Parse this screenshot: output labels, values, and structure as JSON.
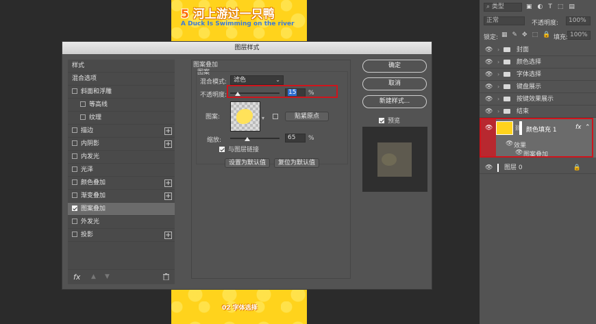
{
  "canvas": {
    "title_num": "5",
    "title": "河上游过一只鸭",
    "subtitle": "A Duck Is Swimming on the river",
    "footer": "02 字体选择",
    "bg_color": "#ffd31c"
  },
  "dialog": {
    "title": "图层样式",
    "style_list": [
      {
        "label": "样式",
        "checkbox": null,
        "indent": false,
        "plus": false,
        "active": false
      },
      {
        "label": "混合选项",
        "checkbox": null,
        "indent": false,
        "plus": false,
        "active": false
      },
      {
        "label": "斜面和浮雕",
        "checkbox": false,
        "indent": false,
        "plus": false,
        "active": false
      },
      {
        "label": "等高线",
        "checkbox": false,
        "indent": true,
        "plus": false,
        "active": false
      },
      {
        "label": "纹理",
        "checkbox": false,
        "indent": true,
        "plus": false,
        "active": false
      },
      {
        "label": "描边",
        "checkbox": false,
        "indent": false,
        "plus": true,
        "active": false
      },
      {
        "label": "内阴影",
        "checkbox": false,
        "indent": false,
        "plus": true,
        "active": false
      },
      {
        "label": "内发光",
        "checkbox": false,
        "indent": false,
        "plus": false,
        "active": false
      },
      {
        "label": "光泽",
        "checkbox": false,
        "indent": false,
        "plus": false,
        "active": false
      },
      {
        "label": "颜色叠加",
        "checkbox": false,
        "indent": false,
        "plus": true,
        "active": false
      },
      {
        "label": "渐变叠加",
        "checkbox": false,
        "indent": false,
        "plus": true,
        "active": false
      },
      {
        "label": "图案叠加",
        "checkbox": true,
        "indent": false,
        "plus": false,
        "active": true
      },
      {
        "label": "外发光",
        "checkbox": false,
        "indent": false,
        "plus": false,
        "active": false
      },
      {
        "label": "投影",
        "checkbox": false,
        "indent": false,
        "plus": true,
        "active": false
      }
    ],
    "footer": {
      "fx": "fx",
      "up": "▲",
      "down": "▼",
      "trash": "🗑"
    },
    "section_title": "图案叠加",
    "group_title": "图案",
    "blend_mode_label": "混合模式:",
    "blend_mode_value": "滤色",
    "opacity_label": "不透明度:",
    "opacity_value": "15",
    "opacity_level": 0.15,
    "percent": "%",
    "pattern_label": "图案:",
    "snap_origin_button": "贴紧原点",
    "scale_label": "缩放:",
    "scale_value": "65",
    "scale_level": 0.35,
    "link_label": "与图层链接",
    "link_checked": true,
    "set_default_button": "设置为默认值",
    "reset_default_button": "复位为默认值",
    "ok_button": "确定",
    "cancel_button": "取消",
    "new_style_button": "新建样式...",
    "preview_label": "预览",
    "preview_checked": true
  },
  "layers_panel": {
    "kind_placeholder": "类型",
    "blend_mode": "正常",
    "opacity_label": "不透明度:",
    "opacity_value": "100%",
    "lock_label": "锁定:",
    "fill_label": "填充:",
    "fill_value": "100%",
    "folders": [
      "封面",
      "颜色选择",
      "字体选择",
      "键盘展示",
      "按键效果展示",
      "结束"
    ],
    "selected_layer": {
      "name": "颜色填充 1",
      "fx": "fx",
      "effects_label": "效果",
      "effect": "图案叠加"
    },
    "bottom_layer": "图层 0",
    "accent_red": "#d0141c"
  }
}
